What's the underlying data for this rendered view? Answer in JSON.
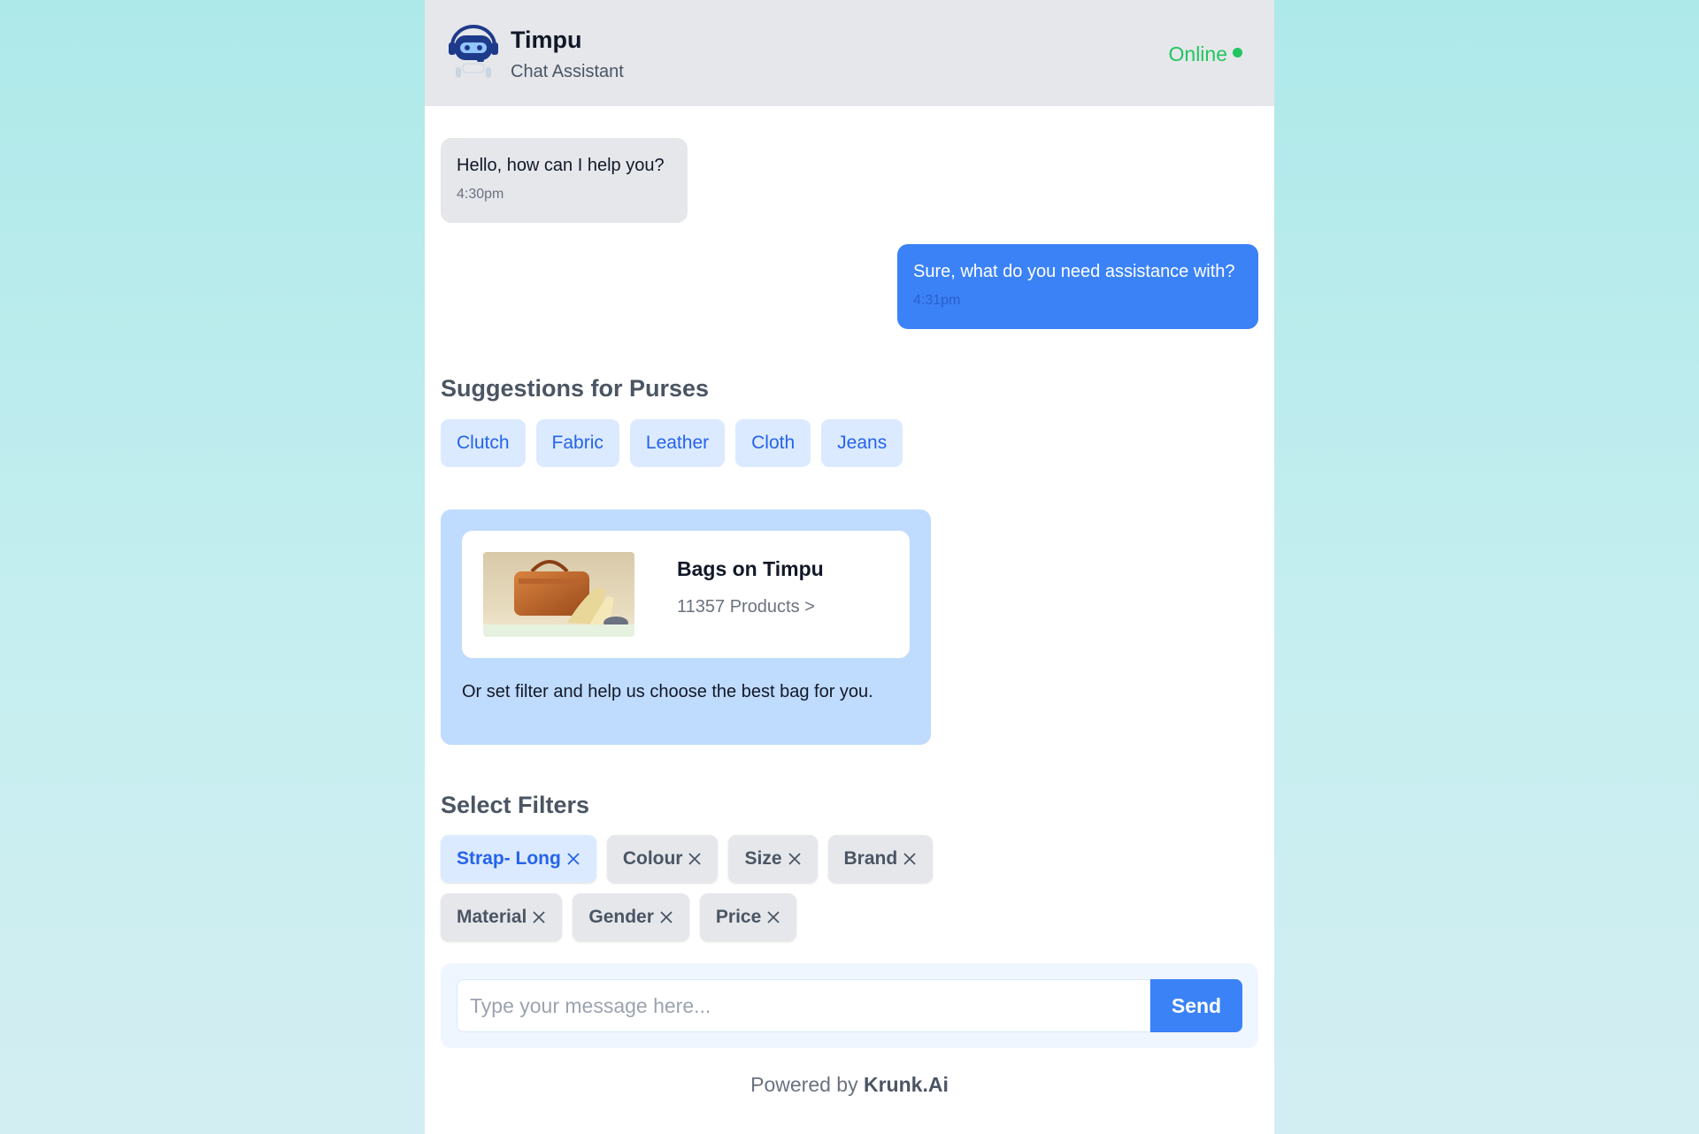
{
  "header": {
    "name": "Timpu",
    "role": "Chat Assistant",
    "status": "Online",
    "status_color": "#22c55e"
  },
  "messages": [
    {
      "sender": "bot",
      "text": "Hello, how can I help you?",
      "time": "4:30pm"
    },
    {
      "sender": "user",
      "text": "Sure, what do you need assistance with?",
      "time": "4:31pm"
    }
  ],
  "suggestions": {
    "title": "Suggestions for Purses",
    "items": [
      "Clutch",
      "Fabric",
      "Leather",
      "Cloth",
      "Jeans"
    ]
  },
  "product_card": {
    "title": "Bags on Timpu",
    "count": "11357 Products >",
    "note": "Or set filter and help us choose the best bag for you."
  },
  "filters": {
    "title": "Select Filters",
    "items": [
      "Strap- Long",
      "Colour",
      "Size",
      "Brand",
      "Material",
      "Gender",
      "Price"
    ],
    "active": "Strap- Long"
  },
  "composer": {
    "placeholder": "Type your message here...",
    "send_label": "Send"
  },
  "footer": {
    "prefix": "Powered by",
    "brand": "Krunk.Ai"
  },
  "colors": {
    "accent": "#3b82f6",
    "chip_bg": "#dbeafe",
    "card_bg": "#bfdbfe"
  }
}
